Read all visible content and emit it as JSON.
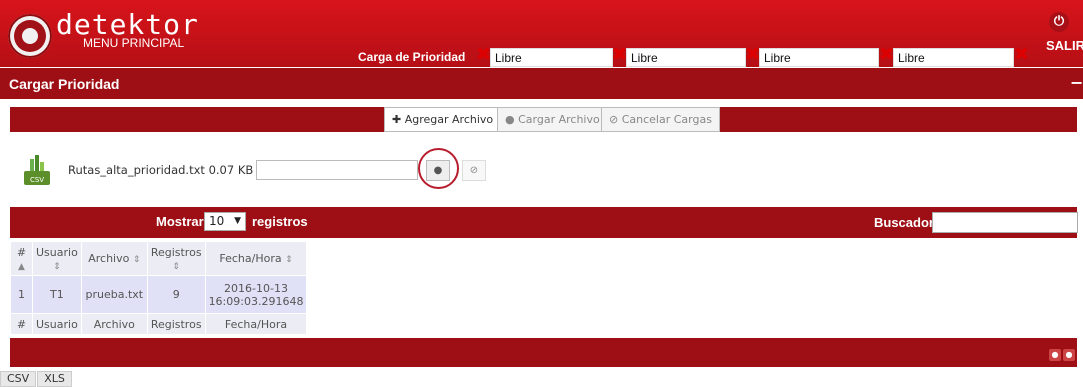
{
  "header": {
    "brand": "detektor",
    "subtitle": "MENU PRINCIPAL",
    "active_tab": "Carga de Prioridad",
    "slots": [
      "Libre",
      "Libre",
      "Libre",
      "Libre"
    ],
    "close_glyph": "✖",
    "logout_label": "SALIR"
  },
  "section": {
    "title": "Cargar Prioridad",
    "collapse_glyph": "−"
  },
  "toolbar": {
    "add_label": "Agregar Archivo",
    "upload_label": "Cargar Archivo",
    "cancel_label": "Cancelar Cargas"
  },
  "upload": {
    "file_name": "Rutas_alta_prioridad.txt",
    "file_size": "0.07 KB",
    "progress": 0
  },
  "table_controls": {
    "show_label": "Mostrar",
    "page_size": "10",
    "records_label": "registros",
    "search_label": "Buscador:",
    "search_value": ""
  },
  "table": {
    "columns": [
      "#",
      "Usuario",
      "Archivo",
      "Registros",
      "Fecha/Hora"
    ],
    "rows": [
      {
        "num": "1",
        "usuario": "T1",
        "archivo": "prueba.txt",
        "registros": "9",
        "fecha": "2016-10-13",
        "hora": "16:09:03.291648"
      }
    ]
  },
  "export": {
    "csv": "CSV",
    "xls": "XLS"
  },
  "colors": {
    "header_red": "#d8141b",
    "bar_red": "#9d0f14",
    "row_blue": "#e0e1f6"
  }
}
